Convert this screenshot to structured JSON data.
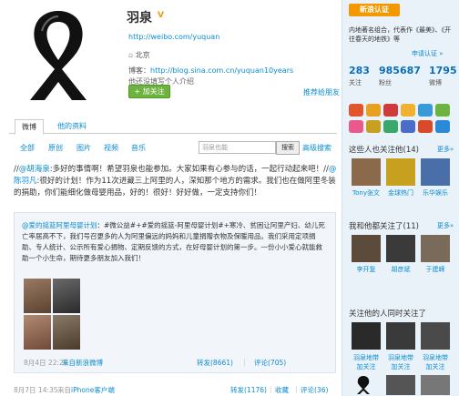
{
  "profile": {
    "name": "羽泉",
    "url": "http://weibo.com/yuquan",
    "location": "北京",
    "blog_label": "博客：",
    "blog_url": "http://blog.sina.com.cn/yuquan10years",
    "intro": "他还没填写个人介绍",
    "follow_label": "+ 加关注",
    "recommend_label": "推荐给朋友"
  },
  "tabs": {
    "weibo": "微博",
    "profile": "他的资料"
  },
  "filters": [
    "全部",
    "原创",
    "图片",
    "视频",
    "音乐"
  ],
  "search": {
    "placeholder": "羽泉也能",
    "button": "搜索",
    "advanced": "高级搜索"
  },
  "post": {
    "mention1": "@胡海泉",
    "text1": ":多好的事情啊！希望羽泉也能参加。大家如果有心参与的话，一起行动起来吧！",
    "sep": "//",
    "mention2": "@陈羽凡",
    "text2": ":很好的计划！作为11次进藏三上阿里的人，深知那个地方的需求。我们也在做阿里冬装的捐助，你们能细化做母婴用品，好的！很好！好好做，一定支持你们！",
    "date": "8月7日 14:35",
    "source_prefix": "来自",
    "source": "iPhone客户端",
    "forward": "转发(1176)",
    "favorite": "收藏",
    "comment": "评论(36)"
  },
  "repost": {
    "mention": "@爱的摇篮阿里母婴计划",
    "text": "：#微公益#+#爱的摇篮-阿里母婴计划#+寒冷、贫困让阿里产妇、幼儿死亡率居高不下，我们号召更多的人为阿里偏远的妈妈和儿童捐赠衣物及保暖用品。我们采用定项捐助、专人统计、公示所有爱心捐物、定期反馈的方式，在好母婴计划的第一步。一份小小爱心就能救助一个小生命，期待更多朋友加入我们！",
    "date": "8月4日 22:29",
    "source": "来自新浪微博",
    "forward": "转发(8661)",
    "comment": "评论(705)"
  },
  "sidebar": {
    "badge": "新浪认证",
    "desc": "内地著名组合，代表作《最美》、《开往春天的地铁》等",
    "apply": "申请认证 »",
    "stats": [
      {
        "num": "283",
        "label": "关注"
      },
      {
        "num": "985687",
        "label": "粉丝"
      },
      {
        "num": "1795",
        "label": "微博"
      }
    ],
    "also_follow_title": "这些人也关注他(14)",
    "also_follow": [
      {
        "name": "Tony张文",
        "color": "#8a6a4a"
      },
      {
        "name": "金球热门",
        "color": "#c8a020"
      },
      {
        "name": "乐华娱乐",
        "color": "#4a6ea8"
      }
    ],
    "mutual_title": "我和他都关注了(11)",
    "mutual": [
      {
        "name": "李开复",
        "color": "#5c4a3a"
      },
      {
        "name": "胡彦斌",
        "color": "#3a3a3a"
      },
      {
        "name": "于建嵘",
        "color": "#7a6a5a"
      }
    ],
    "followed_title": "关注他的人同时关注了",
    "followed": [
      {
        "name": "羽泉地带",
        "tag": "加关注",
        "color": "#2a2a2a"
      },
      {
        "name": "羽泉地带",
        "tag": "加关注",
        "color": "#3a3a3a"
      },
      {
        "name": "羽泉地带",
        "tag": "加关注",
        "color": "#4a4a4a"
      }
    ],
    "more": "更多»"
  },
  "colors": {
    "link": "#0a8cd2",
    "follow_green": "#6db33f",
    "badge_orange": "#f39800",
    "sidebar_bg": "#e9f2f9"
  }
}
